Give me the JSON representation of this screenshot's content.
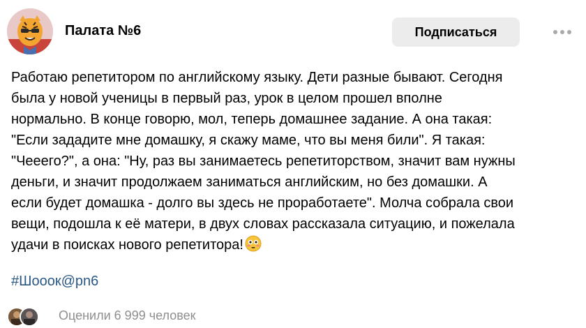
{
  "header": {
    "community_name": "Палата №6",
    "subscribe_label": "Подписаться",
    "avatar_icon": "cartoon-tiger-avatar",
    "more_icon": "more-horizontal-icon"
  },
  "post": {
    "lines": [
      "Работаю репетитором по английскому языку. Дети разные бывают. Сегодня",
      "была у новой ученицы в первый раз, урок в целом прошел вполне",
      "нормально. В конце говорю, мол, теперь домашнее задание. А она такая:",
      "\"Если зададите мне домашку, я скажу маме, что вы меня били\". Я такая:",
      "\"Чееего?\", а она: \"Ну, раз вы занимаетесь репетиторством, значит вам нужны",
      "деньги, и значит продолжаем заниматься английским, но без домашки. А",
      "если будет домашка - долго вы здесь не проработаете\". Молча собрала свои",
      "вещи, подошла к её матери, в двух словах рассказала ситуацию, и пожелала",
      "удачи в поисках нового репетитора!"
    ],
    "emoji": "flushed-face-emoji",
    "hashtag": "#Шооок@pn6"
  },
  "footer": {
    "reactions_text": "Оценили 6 999 человек"
  },
  "colors": {
    "accent_link": "#2a5885",
    "muted_text": "#8e8e8e",
    "button_bg": "#ececec",
    "avatar_bg": "#e9c9c8"
  }
}
